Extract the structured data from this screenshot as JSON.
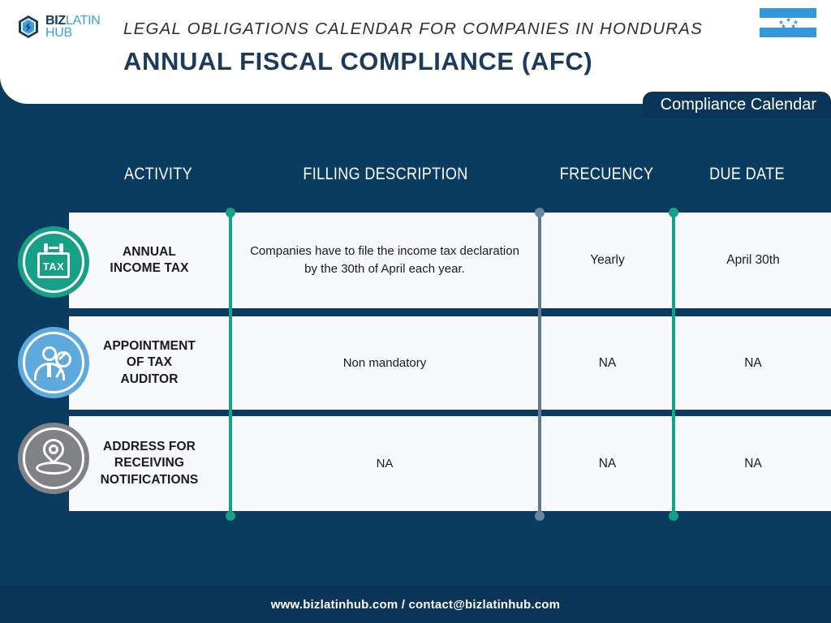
{
  "brand": {
    "logo_biz": "BIZ",
    "logo_latin": "LATIN",
    "logo_hub": "HUB",
    "logo_mark_icon": "bizlatinhub-hexagon-icon"
  },
  "header": {
    "subtitle": "LEGAL OBLIGATIONS CALENDAR FOR COMPANIES IN HONDURAS",
    "title": "ANNUAL FISCAL COMPLIANCE (AFC)",
    "flag_icon": "honduras-flag-icon",
    "tab_label": "Compliance Calendar"
  },
  "table": {
    "columns": [
      "ACTIVITY",
      "FILLING DESCRIPTION",
      "FRECUENCY",
      "DUE DATE"
    ],
    "rows": [
      {
        "icon": "tax-calendar-icon",
        "icon_text": "TAX",
        "activity": "ANNUAL\nINCOME TAX",
        "description": "Companies have to file the income tax declaration by the 30th of April each year.",
        "frequency": "Yearly",
        "due_date": "April 30th"
      },
      {
        "icon": "tax-auditor-person-magnifier-icon",
        "icon_text": "",
        "activity": "APPOINTMENT\nOF TAX\nAUDITOR",
        "description": "Non mandatory",
        "frequency": "NA",
        "due_date": "NA"
      },
      {
        "icon": "location-pin-icon",
        "icon_text": "",
        "activity": "ADDRESS FOR\nRECEIVING\nNOTIFICATIONS",
        "description": "NA",
        "frequency": "NA",
        "due_date": "NA"
      }
    ]
  },
  "footer": {
    "text": "www.bizlatinhub.com / contact@bizlatinhub.com"
  },
  "colors": {
    "background_navy": "#0a3b61",
    "header_white": "#ffffff",
    "title_navy": "#1b3a5e",
    "tab_navy": "#0b3558",
    "row_bg": "#f7f9fc",
    "accent_green": "#16a085",
    "accent_slate": "#5d7a96",
    "icon_blue": "#5ea9dd",
    "icon_gray": "#808285",
    "flag_blue": "#3498db"
  }
}
